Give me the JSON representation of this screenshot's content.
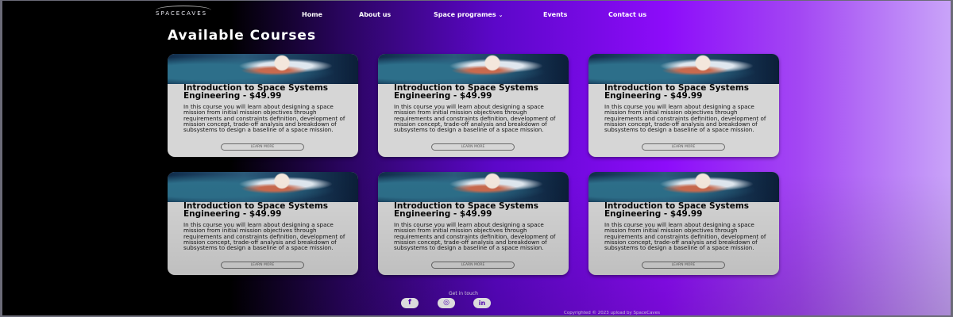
{
  "brand": {
    "logo_text": "SPACECAVES"
  },
  "nav": {
    "items": [
      {
        "label": "Home"
      },
      {
        "label": "About us"
      },
      {
        "label": "Space programes"
      },
      {
        "label": "Events"
      },
      {
        "label": "Contact us"
      }
    ],
    "dropdown_caret": "⌄"
  },
  "page": {
    "title": "Available Courses"
  },
  "courses": [
    {
      "title": "Introduction to Space Systems Engineering - $49.99",
      "description": "In this course you will learn about designing a space mission from initial mission objectives through requirements and constraints definition, development of mission concept, trade-off analysis and breakdown of subsystems to design a baseline of a space mission.",
      "button": "LEARN MORE"
    },
    {
      "title": "Introduction to Space Systems Engineering - $49.99",
      "description": "In this course you will learn about designing a space mission from initial mission objectives through requirements and constraints definition, development of mission concept, trade-off analysis and breakdown of subsystems to design a baseline of a space mission.",
      "button": "LEARN MORE"
    },
    {
      "title": "Introduction to Space Systems Engineering - $49.99",
      "description": "In this course you will learn about designing a space mission from initial mission objectives through requirements and constraints definition, development of mission concept, trade-off analysis and breakdown of subsystems to design a baseline of a space mission.",
      "button": "LEARN MORE"
    },
    {
      "title": "Introduction to Space Systems Engineering - $49.99",
      "description": "In this course you will learn about designing a space mission from initial mission objectives through requirements and constraints definition, development of mission concept, trade-off analysis and breakdown of subsystems to design a baseline of a space mission.",
      "button": "LEARN MORE"
    },
    {
      "title": "Introduction to Space Systems Engineering - $49.99",
      "description": "In this course you will learn about designing a space mission from initial mission objectives through requirements and constraints definition, development of mission concept, trade-off analysis and breakdown of subsystems to design a baseline of a space mission.",
      "button": "LEARN MORE"
    },
    {
      "title": "Introduction to Space Systems Engineering - $49.99",
      "description": "In this course you will learn about designing a space mission from initial mission objectives through requirements and constraints definition, development of mission concept, trade-off analysis and breakdown of subsystems to design a baseline of a space mission.",
      "button": "LEARN MORE"
    }
  ],
  "footer": {
    "get_in_touch": "Get in touch",
    "social": [
      {
        "icon": "facebook-icon",
        "glyph": "f"
      },
      {
        "icon": "instagram-icon",
        "glyph": "◎"
      },
      {
        "icon": "linkedin-icon",
        "glyph": "in"
      }
    ],
    "copyright": "Copyrighted © 2023 upload by SpaceCaves"
  },
  "colors": {
    "accent_purple": "#8d0cfa",
    "card_bg": "#d6d6d6"
  }
}
